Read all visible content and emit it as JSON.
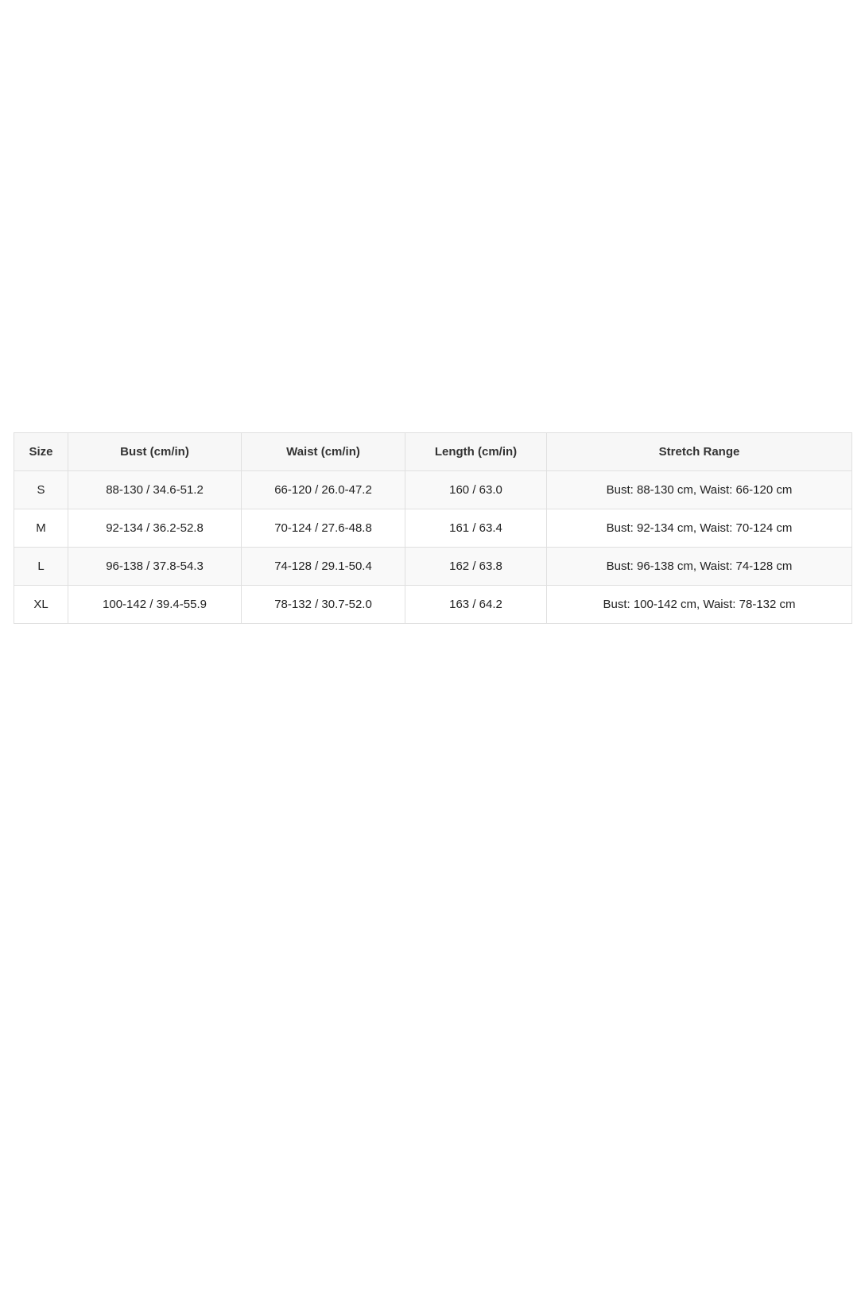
{
  "table": {
    "headers": [
      "Size",
      "Bust (cm/in)",
      "Waist (cm/in)",
      "Length (cm/in)",
      "Stretch Range"
    ],
    "rows": [
      [
        "S",
        "88-130 / 34.6-51.2",
        "66-120 / 26.0-47.2",
        "160 / 63.0",
        "Bust: 88-130 cm, Waist: 66-120 cm"
      ],
      [
        "M",
        "92-134 / 36.2-52.8",
        "70-124 / 27.6-48.8",
        "161 / 63.4",
        "Bust: 92-134 cm, Waist: 70-124 cm"
      ],
      [
        "L",
        "96-138 / 37.8-54.3",
        "74-128 / 29.1-50.4",
        "162 / 63.8",
        "Bust: 96-138 cm, Waist: 74-128 cm"
      ],
      [
        "XL",
        "100-142 / 39.4-55.9",
        "78-132 / 30.7-52.0",
        "163 / 64.2",
        "Bust: 100-142 cm, Waist: 78-132 cm"
      ]
    ]
  }
}
